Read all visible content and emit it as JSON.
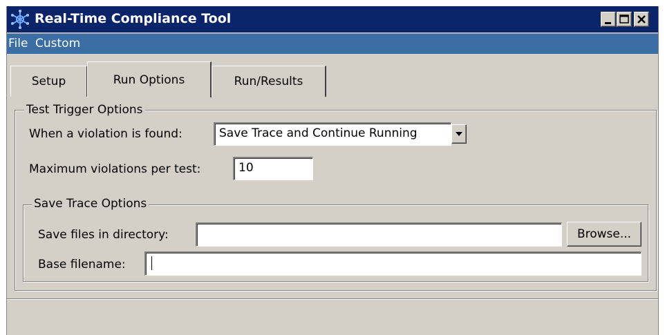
{
  "window": {
    "title": "Real-Time Compliance Tool",
    "colors": {
      "titlebar": "#0a246a",
      "menubar": "#3a6ea5",
      "face": "#d4d0c8"
    }
  },
  "menu": {
    "items": [
      {
        "label": "File"
      },
      {
        "label": "Custom"
      }
    ]
  },
  "tabs": [
    {
      "label": "Setup",
      "active": false
    },
    {
      "label": "Run Options",
      "active": true
    },
    {
      "label": "Run/Results",
      "active": false
    }
  ],
  "trigger": {
    "legend": "Test Trigger Options",
    "violation_label": "When a violation is found:",
    "violation_value": "Save Trace and Continue Running",
    "max_label": "Maximum violations per test:",
    "max_value": "10"
  },
  "save": {
    "legend": "Save Trace Options",
    "dir_label": "Save files in directory:",
    "dir_value": "",
    "browse_label": "Browse...",
    "base_label": "Base filename:",
    "base_value": ""
  },
  "icons": {
    "app": "snowflake-icon",
    "minimize": "minimize-icon",
    "maximize": "maximize-icon",
    "close": "close-icon",
    "dropdown": "chevron-down-icon"
  }
}
